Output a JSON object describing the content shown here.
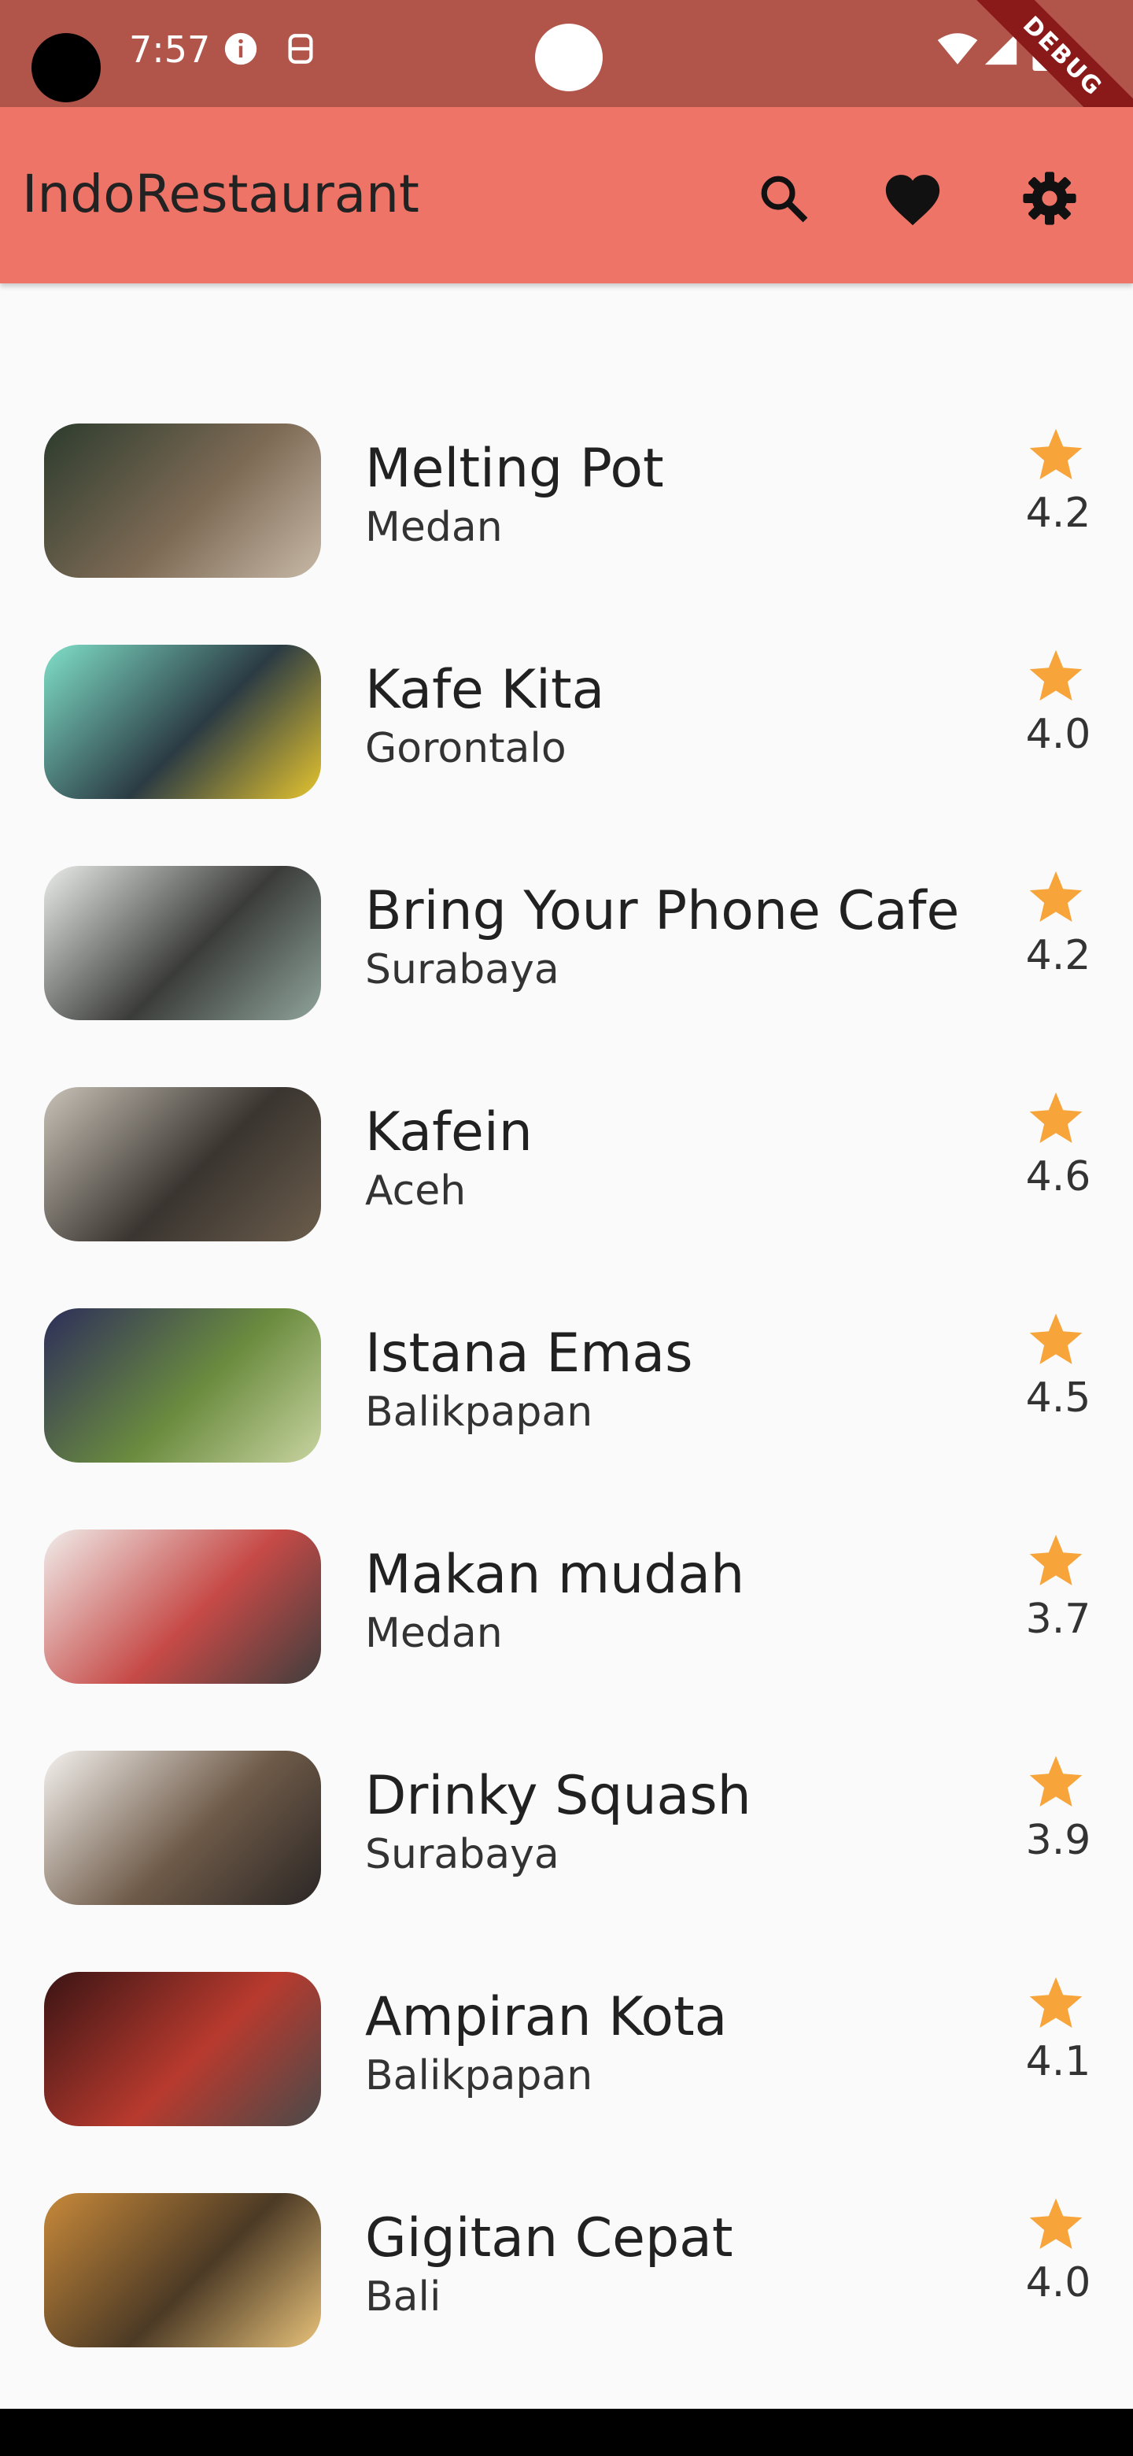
{
  "status_bar": {
    "time": "7:57",
    "debug_label": "DEBUG",
    "icons": [
      "info-icon",
      "sim-icon",
      "wifi-icon",
      "signal-icon",
      "battery-icon"
    ]
  },
  "app_bar": {
    "title": "IndoRestaurant",
    "actions": [
      "search-icon",
      "favorite-heart-icon",
      "settings-gear-icon"
    ]
  },
  "colors": {
    "status_bar": "#b1554b",
    "app_bar": "#ee7467",
    "star": "#f7a53b",
    "background": "#fafafa"
  },
  "restaurants": [
    {
      "name": "Melting Pot",
      "city": "Medan",
      "rating": "4.2",
      "thumb_colors": [
        "#2c3b2d",
        "#7d6a55",
        "#c7b8a6"
      ]
    },
    {
      "name": "Kafe Kita",
      "city": "Gorontalo",
      "rating": "4.0",
      "thumb_colors": [
        "#80e0c8",
        "#2b3b44",
        "#e6c52f"
      ]
    },
    {
      "name": "Bring Your Phone Cafe",
      "city": "Surabaya",
      "rating": "4.2",
      "thumb_colors": [
        "#e9ece8",
        "#3b3c3a",
        "#8fa49a"
      ]
    },
    {
      "name": "Kafein",
      "city": "Aceh",
      "rating": "4.6",
      "thumb_colors": [
        "#c8c2b7",
        "#3a3530",
        "#6b5d4c"
      ]
    },
    {
      "name": "Istana Emas",
      "city": "Balikpapan",
      "rating": "4.5",
      "thumb_colors": [
        "#2d2e5a",
        "#6b8c3f",
        "#c8d4a0"
      ]
    },
    {
      "name": "Makan mudah",
      "city": "Medan",
      "rating": "3.7",
      "thumb_colors": [
        "#f0ecea",
        "#c64a47",
        "#3f3e3d"
      ]
    },
    {
      "name": "Drinky Squash",
      "city": "Surabaya",
      "rating": "3.9",
      "thumb_colors": [
        "#f4f1ee",
        "#6e5a48",
        "#2b2625"
      ]
    },
    {
      "name": "Ampiran Kota",
      "city": "Balikpapan",
      "rating": "4.1",
      "thumb_colors": [
        "#3a1414",
        "#b83a2e",
        "#494a4a"
      ]
    },
    {
      "name": "Gigitan Cepat",
      "city": "Bali",
      "rating": "4.0",
      "thumb_colors": [
        "#c8893a",
        "#4c3a25",
        "#e8c27a"
      ]
    }
  ]
}
